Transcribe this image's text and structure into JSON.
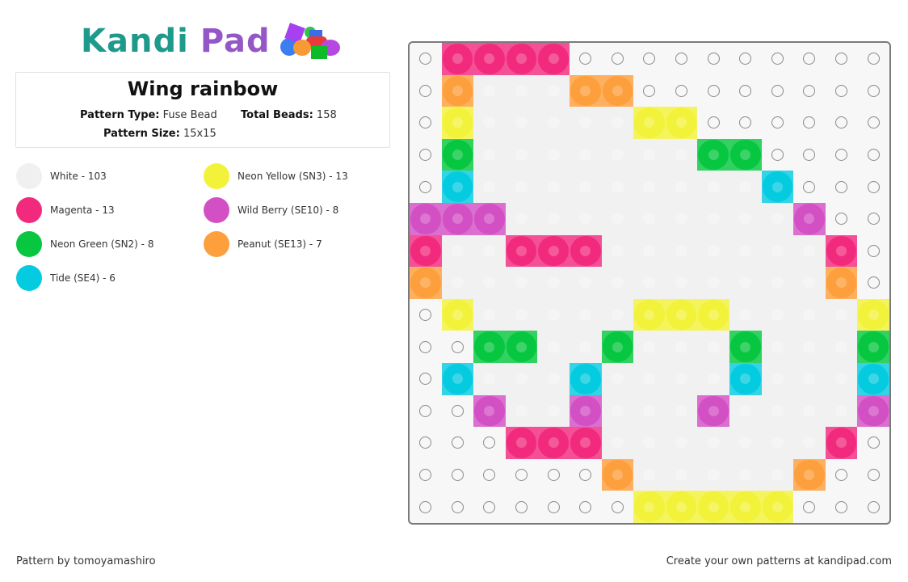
{
  "logo": {
    "part1": "Kandi",
    "part2": "Pad"
  },
  "pattern": {
    "title": "Wing rainbow",
    "type_label": "Pattern Type:",
    "type_value": "Fuse Bead",
    "beads_label": "Total Beads:",
    "beads_value": "158",
    "size_label": "Pattern Size:",
    "size_value": "15x15"
  },
  "legend": [
    {
      "key": "W",
      "label": "White - 103",
      "color": "#f0f0f0"
    },
    {
      "key": "M",
      "label": "Magenta - 13",
      "color": "#f22a7e"
    },
    {
      "key": "G",
      "label": "Neon Green (SN2) - 8",
      "color": "#06c73f"
    },
    {
      "key": "T",
      "label": "Tide (SE4) - 6",
      "color": "#05cbe0"
    },
    {
      "key": "Y",
      "label": "Neon Yellow (SN3) - 13",
      "color": "#f2f23a"
    },
    {
      "key": "B",
      "label": "Wild Berry (SE10) - 8",
      "color": "#d24fc4"
    },
    {
      "key": "P",
      "label": "Peanut (SE13) - 7",
      "color": "#fd9f3c"
    }
  ],
  "grid": {
    "columns": 15,
    "rows": 15,
    "cells": [
      ".MMMM..........",
      ".PWWWPP........",
      ".YWWWWWYY......",
      ".GWWWWWWWGG....",
      ".TWWWWWWWWWT...",
      "BBBWWWWWWWWWB..",
      "MWWMMMWWWWWWWM.",
      "PWWWWWWWWWWWWP.",
      ".YWWWWWYYYWWWWY",
      "..GGWWGWWWGWWWG",
      ".TWWWTWWWWTWWWT",
      "..BWWBWWWBWWWWB",
      "...MMMWWWWWWWM.",
      "......PWWWWWP..",
      ".......YYYYY..."
    ]
  },
  "footer": {
    "author": "Pattern by tomoyamashiro",
    "promo": "Create your own patterns at kandipad.com"
  }
}
